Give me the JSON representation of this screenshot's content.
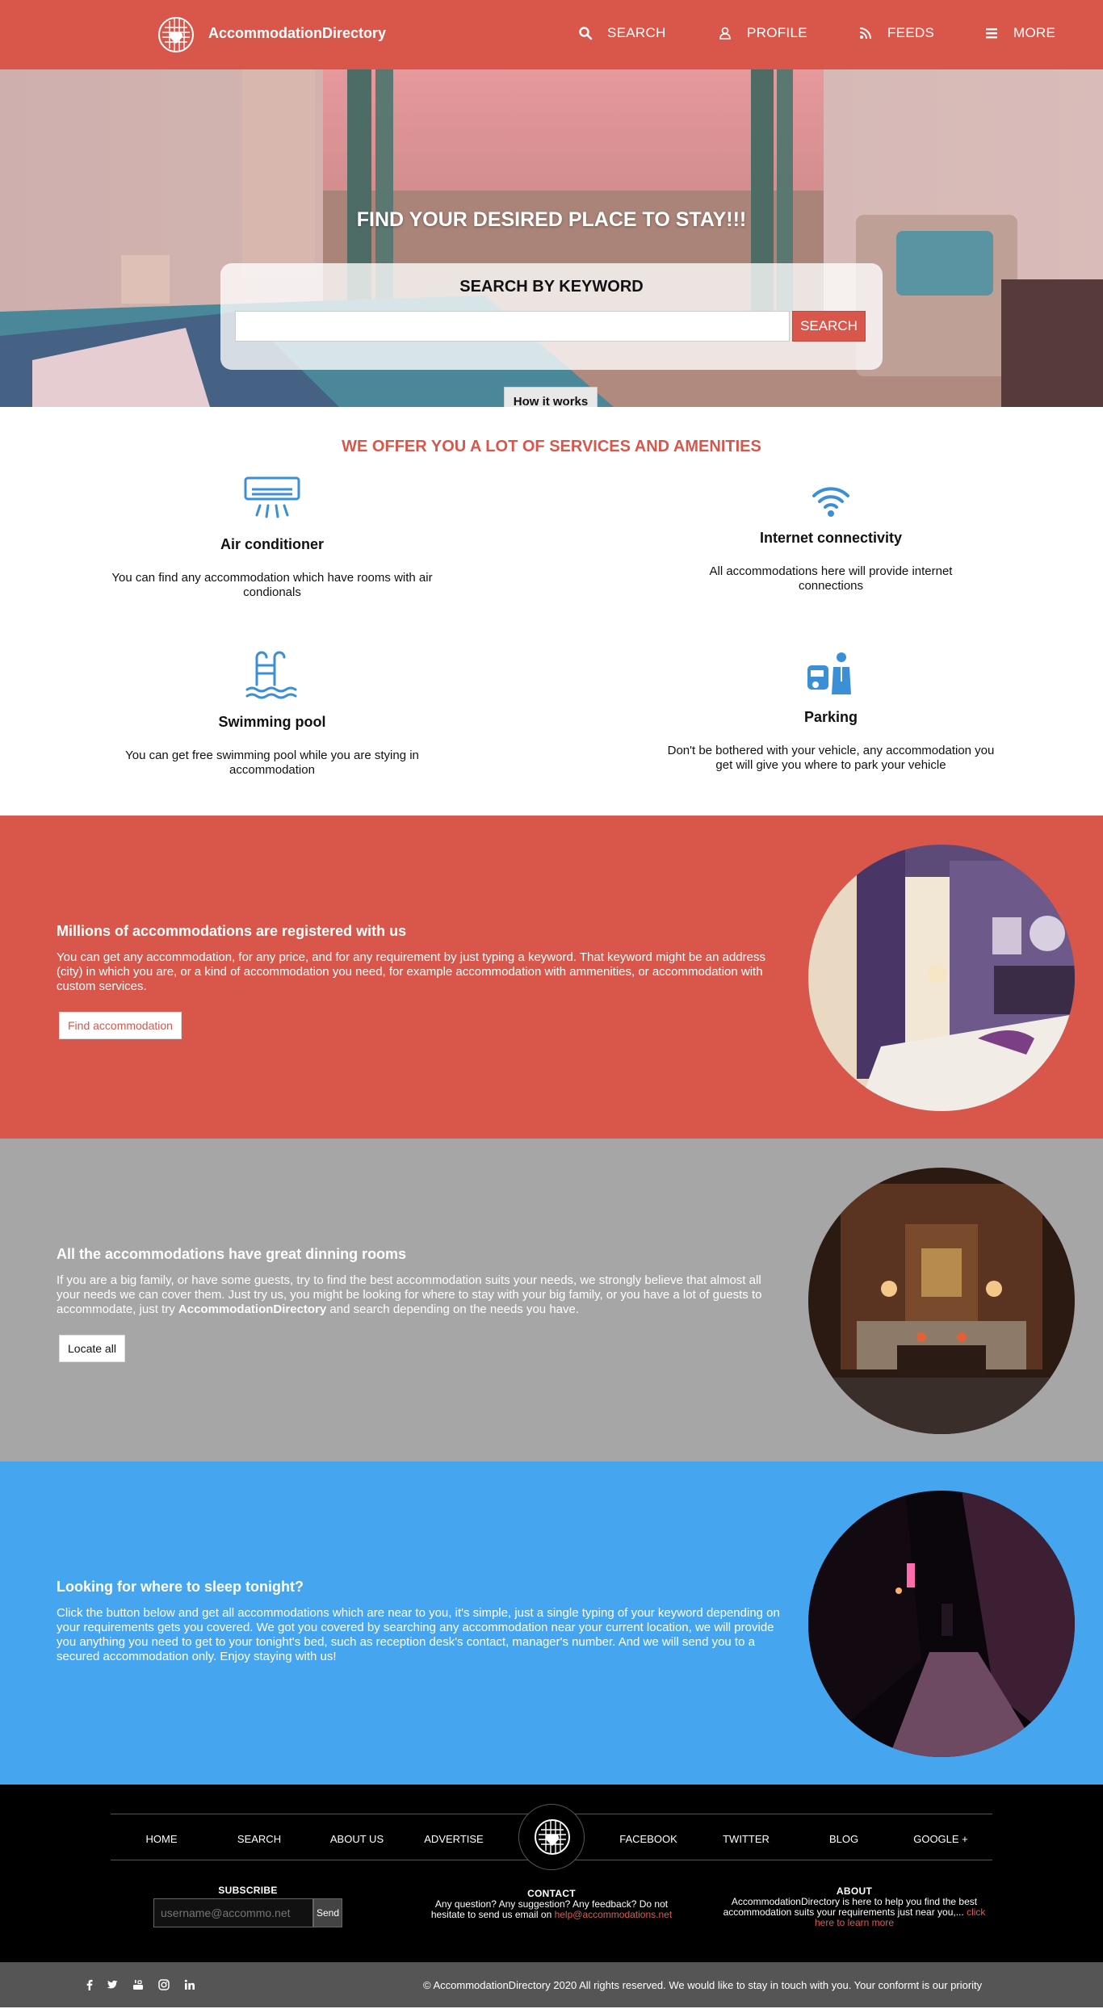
{
  "nav": {
    "brand": "AccommodationDirectory",
    "links": [
      {
        "label": "SEARCH",
        "icon": "search-icon"
      },
      {
        "label": "PROFILE",
        "icon": "user-icon"
      },
      {
        "label": "FEEDS",
        "icon": "rss-icon"
      },
      {
        "label": "MORE",
        "icon": "menu-icon"
      }
    ]
  },
  "hero": {
    "title": "FIND YOUR DESIRED PLACE TO STAY!!!",
    "search_heading": "SEARCH BY KEYWORD",
    "search_value": "",
    "search_button": "SEARCH",
    "how_button": "How it works"
  },
  "services": {
    "title": "WE OFFER YOU A LOT OF SERVICES AND AMENITIES",
    "items": [
      {
        "icon": "air-conditioner-icon",
        "title": "Air conditioner",
        "text": "You can find any accommodation which have rooms with air condionals"
      },
      {
        "icon": "wifi-icon",
        "title": "Internet connectivity",
        "text": "All accommodations here will provide internet connections"
      },
      {
        "icon": "swimming-pool-icon",
        "title": "Swimming pool",
        "text": "You can get free swimming pool while you are stying in accommodation"
      },
      {
        "icon": "parking-icon",
        "title": "Parking",
        "text": "Don't be bothered with your vehicle, any accommodation you get will give you where to park your vehicle"
      }
    ]
  },
  "bands": [
    {
      "title": "Millions of accommodations are registered with us",
      "text": "You can get any accommodation, for any price, and for any requirement by just typing a keyword. That keyword might be an address (city) in which you are, or a kind of accommodation you need, for example accommodation with ammenities, or accommodation with custom services.",
      "button": "Find accommodation",
      "color": "#d9564b"
    },
    {
      "title": "All the accommodations have great dinning rooms",
      "text_before": "If you are a big family, or have some guests, try to find the best accommodation suits your needs, we strongly believe that almost all your needs we can cover them. Just try us, you might be looking for where to stay with your big family, or you have a lot of guests to accommodate, just try ",
      "text_bold": "AccommodationDirectory",
      "text_after": " and search depending on the needs you have.",
      "button": "Locate all",
      "color": "#a6a6a6"
    },
    {
      "title": "Looking for where to sleep tonight?",
      "text": "Click the button below and get all accommodations which are near to you, it's simple, just a single typing of your keyword depending on your requirements gets you covered. We got you covered by searching any accommodation near your current location, we will provide you anything you need to get to your tonight's bed, such as reception desk's contact, manager's number. And we will send you to a secured accommodation only. Enjoy staying with us!",
      "color": "#45a6ef"
    }
  ],
  "footer": {
    "links_left": [
      "HOME",
      "SEARCH",
      "ABOUT US",
      "ADVERTISE"
    ],
    "links_right": [
      "FACEBOOK",
      "TWITTER",
      "BLOG",
      "GOOGLE +"
    ],
    "subscribe": {
      "heading": "SUBSCRIBE",
      "placeholder": "username@accommo.net",
      "button": "Send"
    },
    "contact": {
      "heading": "CONTACT",
      "text": "Any question? Any suggestion? Any feedback? Do not hesitate to send us email on ",
      "email": "help@accommodations.net"
    },
    "about": {
      "heading": "ABOUT",
      "text": "AccommodationDirectory is here to help you find the best accommodation suits your requirements just near you,... ",
      "link": "click here to learn more"
    }
  },
  "bottom": {
    "social": [
      "facebook-icon",
      "twitter-icon",
      "youtube-icon",
      "instagram-icon",
      "linkedin-icon"
    ],
    "copyright": "© AccommodationDirectory 2020 All rights reserved. We would like to stay in touch with you. Your conformt is our priority"
  }
}
